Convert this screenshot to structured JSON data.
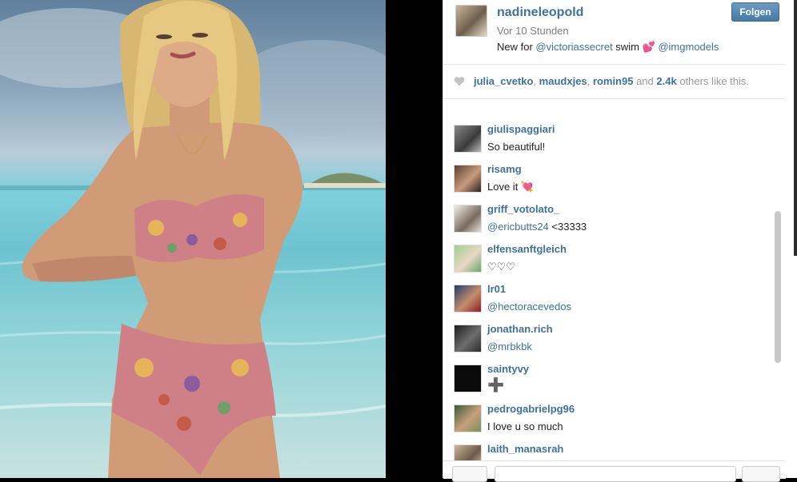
{
  "post": {
    "username": "nadineleopold",
    "time": "Vor 10 Stunden",
    "follow_label": "Folgen",
    "caption": {
      "text_before": "New for ",
      "mention1": "@victoriassecret",
      "text_middle": " swim ",
      "emoji": "💕",
      "mention2": "@imgmodels"
    }
  },
  "likes": {
    "users": [
      "julia_cvetko",
      "maudxjes",
      "romin95"
    ],
    "sep": ", ",
    "and": " and ",
    "count": "2.4k",
    "suffix": " others like this."
  },
  "comments": [
    {
      "user": "giulispaggiari",
      "text": "So beautiful!"
    },
    {
      "user": "risamg",
      "text": "Love it 💘"
    },
    {
      "user": "griff_votolato_",
      "mention": "@ericbutts24",
      "text": " <33333"
    },
    {
      "user": "elfensanftgleich",
      "text": "♡♡♡"
    },
    {
      "user": "lr01",
      "mention": "@hectoracevedos"
    },
    {
      "user": "jonathan.rich",
      "mention": "@mrbkbk"
    },
    {
      "user": "saintyvy",
      "text": "➕"
    },
    {
      "user": "pedrogabrielpg96",
      "text": "I love u so much"
    },
    {
      "user": "laith_manasrah",
      "text": ""
    }
  ],
  "icons": {
    "like": "heart-icon",
    "heart_color": "#c4c4c4"
  },
  "colors": {
    "link": "#3f729b",
    "follow_button": "#467aa7"
  }
}
